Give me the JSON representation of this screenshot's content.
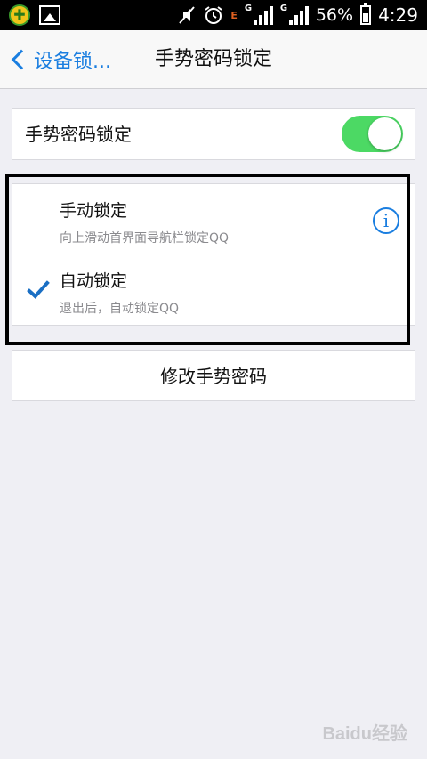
{
  "status_bar": {
    "battery": "56%",
    "time": "4:29",
    "network1": "G",
    "network2": "G",
    "edge": "E",
    "icons": [
      "app-notification-icon",
      "image-icon",
      "mute-icon",
      "alarm-icon",
      "signal-icon",
      "battery-icon"
    ]
  },
  "nav": {
    "back_label": "设备锁...",
    "title": "手势密码锁定"
  },
  "toggle_row": {
    "label": "手势密码锁定",
    "enabled": true
  },
  "options": [
    {
      "title": "手动锁定",
      "subtitle": "向上滑动首界面导航栏锁定QQ",
      "selected": false
    },
    {
      "title": "自动锁定",
      "subtitle": "退出后，自动锁定QQ",
      "selected": true
    }
  ],
  "change_button": {
    "label": "修改手势密码"
  },
  "watermark": "Baidu经验",
  "colors": {
    "accent": "#1a7ee0",
    "switch_on": "#4cd964",
    "background": "#efeff4"
  }
}
